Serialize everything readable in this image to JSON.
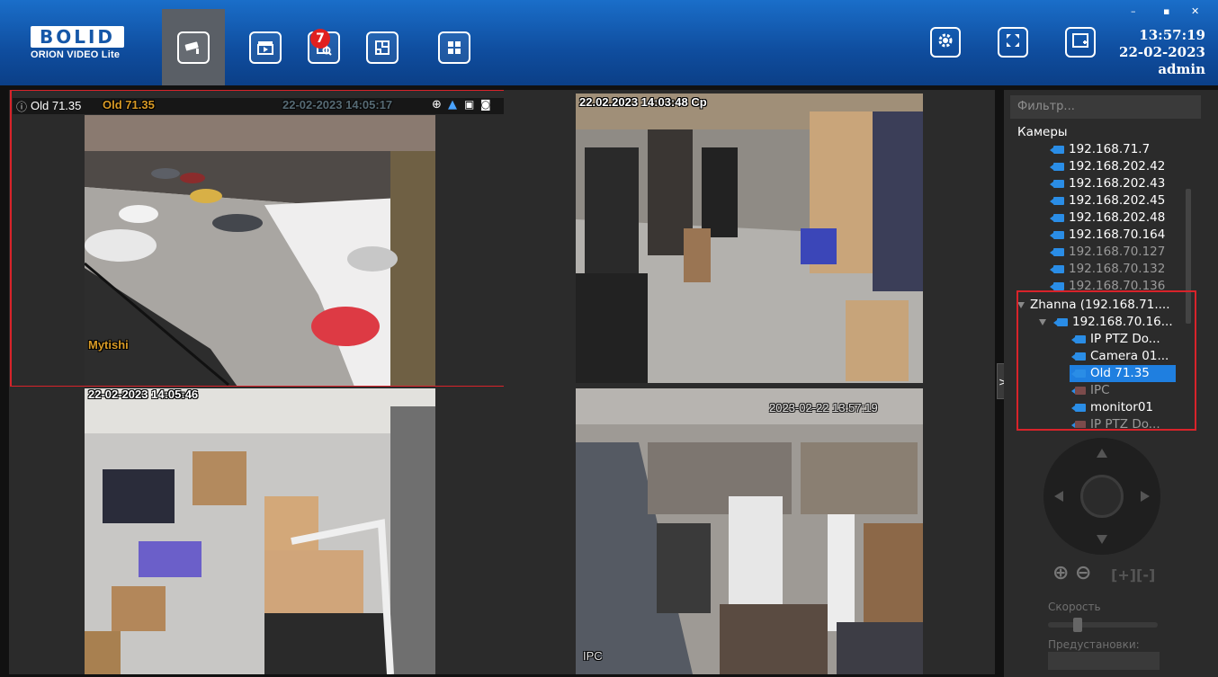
{
  "header": {
    "logo_mark": "BOLID",
    "logo_sub": "ORION VIDEO Lite",
    "nav": [
      {
        "name": "nav-cameras",
        "icon": "cctv-camera-icon",
        "active": true
      },
      {
        "name": "nav-archive",
        "icon": "clapperboard-icon"
      },
      {
        "name": "nav-events",
        "icon": "document-search-icon",
        "badge": "7"
      },
      {
        "name": "nav-layout-editor",
        "icon": "floor-plan-icon"
      },
      {
        "name": "nav-grid",
        "icon": "grid-layout-icon"
      }
    ],
    "badge_count": "7",
    "time": "13:57:19",
    "date": "22-02-2023",
    "user": "admin",
    "right_buttons": [
      "settings-gear-icon",
      "fullscreen-icon",
      "add-window-icon"
    ]
  },
  "cameras": [
    {
      "title": "Old 71.35",
      "overlay_title": "Old 71.35",
      "label_bottom": "Mytishi",
      "timestamp": "22-02-2023 14:05:17"
    },
    {
      "timestamp": "22.02.2023 14:03:48 Ср"
    },
    {
      "timestamp": "22-02-2023 14:05:46"
    },
    {
      "timestamp": "2023-02-22 13:57:19",
      "label_bottom": "IPC"
    }
  ],
  "sidebar": {
    "filter_placeholder": "Фильтр...",
    "tree_root": "Камеры",
    "items": [
      {
        "label": "192.168.71.7"
      },
      {
        "label": "192.168.202.42"
      },
      {
        "label": "192.168.202.43"
      },
      {
        "label": "192.168.202.45"
      },
      {
        "label": "192.168.202.48"
      },
      {
        "label": "192.168.70.164"
      },
      {
        "label": "192.168.70.127"
      },
      {
        "label": "192.168.70.132"
      },
      {
        "label": "192.168.70.136"
      }
    ],
    "server_node": "Zhanna (192.168.71....",
    "server_child": "192.168.70.16...",
    "sub_items": [
      {
        "label": "IP PTZ Do..."
      },
      {
        "label": "Camera 01..."
      },
      {
        "label": "Old 71.35",
        "selected": true
      },
      {
        "label": "IPC",
        "offline": true
      },
      {
        "label": "monitor01"
      },
      {
        "label": "IP PTZ Do...",
        "offline": true
      }
    ],
    "expand_btn": ">",
    "speed_label": "Скорость",
    "speed_value": 0.28,
    "presets_label": "Предустановки:"
  },
  "colors": {
    "accent": "#1a6ec9",
    "selection": "#d8232a",
    "tree_selected": "#1f7fe0"
  }
}
